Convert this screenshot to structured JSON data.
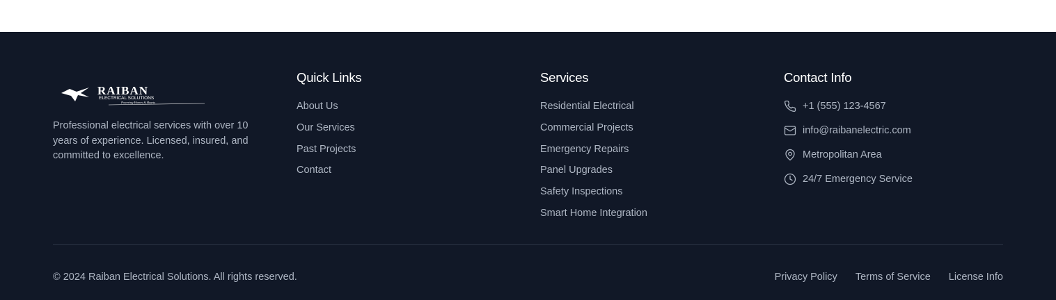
{
  "brand": {
    "logo_name": "RAIBAN",
    "logo_subtitle": "ELECTRICAL SOLUTIONS",
    "logo_slogan": "Powering Homes & Hearts",
    "tagline": "Professional electrical services with over 10 years of experience. Licensed, insured, and committed to excellence."
  },
  "quick_links": {
    "title": "Quick Links",
    "items": [
      "About Us",
      "Our Services",
      "Past Projects",
      "Contact"
    ]
  },
  "services": {
    "title": "Services",
    "items": [
      "Residential Electrical",
      "Commercial Projects",
      "Emergency Repairs",
      "Panel Upgrades",
      "Safety Inspections",
      "Smart Home Integration"
    ]
  },
  "contact": {
    "title": "Contact Info",
    "items": [
      {
        "icon": "phone-icon",
        "text": "+1 (555) 123-4567"
      },
      {
        "icon": "mail-icon",
        "text": "info@raibanelectric.com"
      },
      {
        "icon": "map-pin-icon",
        "text": "Metropolitan Area"
      },
      {
        "icon": "clock-icon",
        "text": "24/7 Emergency Service"
      }
    ]
  },
  "bottom": {
    "copyright": "© 2024 Raiban Electrical Solutions. All rights reserved.",
    "links": [
      "Privacy Policy",
      "Terms of Service",
      "License Info"
    ]
  },
  "colors": {
    "background": "#111827",
    "text_muted": "#aeb6c3",
    "heading": "#ffffff",
    "divider": "#2a3344"
  }
}
